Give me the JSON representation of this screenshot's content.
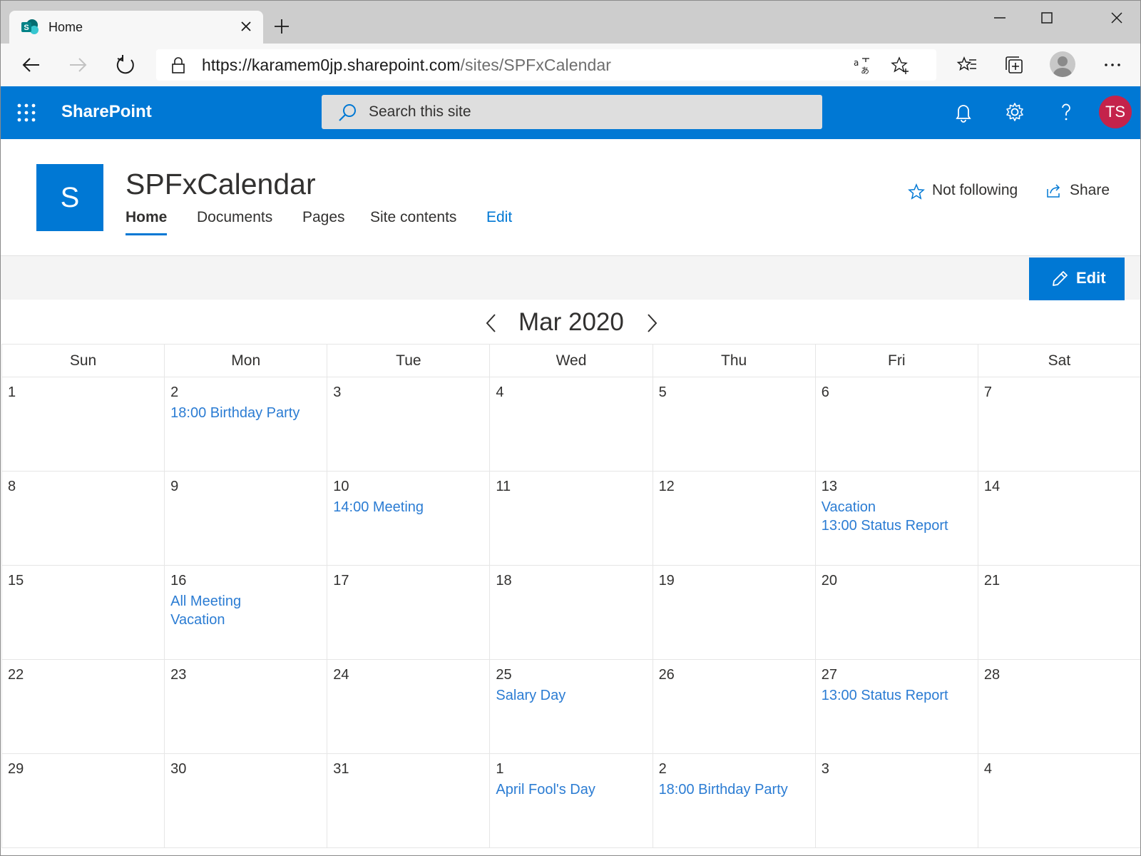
{
  "browser": {
    "tab_title": "Home",
    "url_host": "https://karamem0jp.sharepoint.com",
    "url_path": "/sites/SPFxCalendar"
  },
  "suite": {
    "brand": "SharePoint",
    "search_placeholder": "Search this site",
    "user_initials": "TS",
    "accent": "#0078d4"
  },
  "site": {
    "logo_letter": "S",
    "title": "SPFxCalendar",
    "nav": [
      "Home",
      "Documents",
      "Pages",
      "Site contents",
      "Edit"
    ],
    "follow_label": "Not following",
    "share_label": "Share",
    "edit_button": "Edit"
  },
  "calendar": {
    "month_label": "Mar 2020",
    "weekdays": [
      "Sun",
      "Mon",
      "Tue",
      "Wed",
      "Thu",
      "Fri",
      "Sat"
    ],
    "event_color": "#2b7cd3",
    "weeks": [
      [
        {
          "day": "1",
          "events": []
        },
        {
          "day": "2",
          "events": [
            "18:00 Birthday Party"
          ]
        },
        {
          "day": "3",
          "events": []
        },
        {
          "day": "4",
          "events": []
        },
        {
          "day": "5",
          "events": []
        },
        {
          "day": "6",
          "events": []
        },
        {
          "day": "7",
          "events": []
        }
      ],
      [
        {
          "day": "8",
          "events": []
        },
        {
          "day": "9",
          "events": []
        },
        {
          "day": "10",
          "events": [
            "14:00 Meeting"
          ]
        },
        {
          "day": "11",
          "events": []
        },
        {
          "day": "12",
          "events": []
        },
        {
          "day": "13",
          "events": [
            "Vacation",
            "13:00 Status Report"
          ]
        },
        {
          "day": "14",
          "events": []
        }
      ],
      [
        {
          "day": "15",
          "events": []
        },
        {
          "day": "16",
          "events": [
            "All Meeting",
            "Vacation"
          ]
        },
        {
          "day": "17",
          "events": []
        },
        {
          "day": "18",
          "events": []
        },
        {
          "day": "19",
          "events": []
        },
        {
          "day": "20",
          "events": []
        },
        {
          "day": "21",
          "events": []
        }
      ],
      [
        {
          "day": "22",
          "events": []
        },
        {
          "day": "23",
          "events": []
        },
        {
          "day": "24",
          "events": []
        },
        {
          "day": "25",
          "events": [
            "Salary Day"
          ]
        },
        {
          "day": "26",
          "events": []
        },
        {
          "day": "27",
          "events": [
            "13:00 Status Report"
          ]
        },
        {
          "day": "28",
          "events": []
        }
      ],
      [
        {
          "day": "29",
          "events": []
        },
        {
          "day": "30",
          "events": []
        },
        {
          "day": "31",
          "events": []
        },
        {
          "day": "1",
          "events": [
            "April Fool's Day"
          ]
        },
        {
          "day": "2",
          "events": [
            "18:00 Birthday Party"
          ]
        },
        {
          "day": "3",
          "events": []
        },
        {
          "day": "4",
          "events": []
        }
      ]
    ]
  }
}
